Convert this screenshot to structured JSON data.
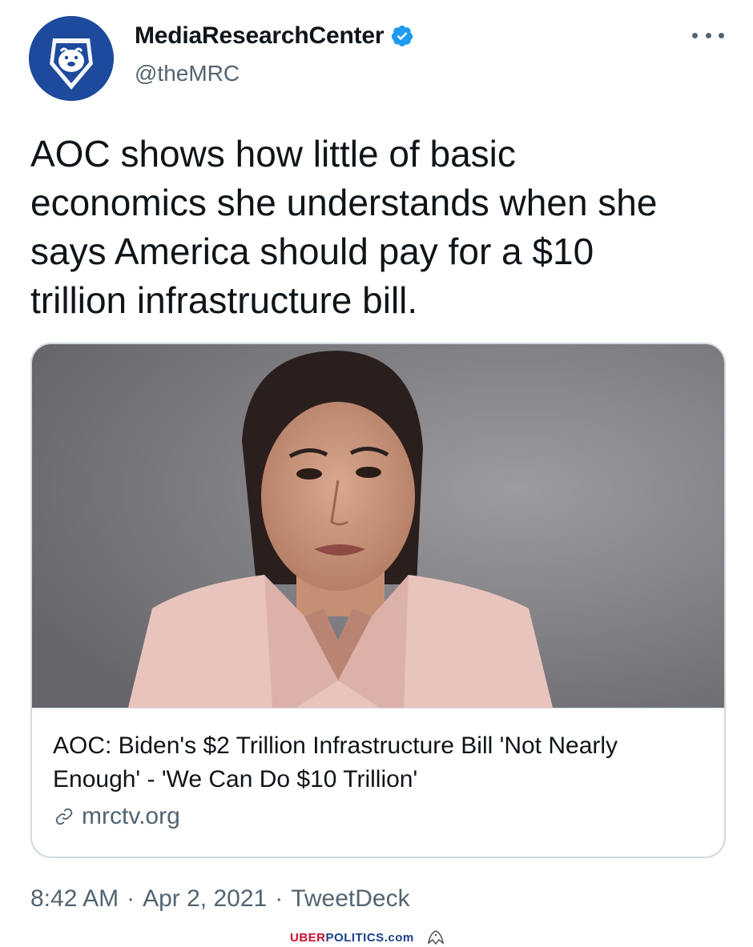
{
  "author": {
    "display_name": "MediaResearchCenter",
    "handle": "@theMRC",
    "verified": true
  },
  "tweet": {
    "text": "AOC shows how little of basic\neconomics she understands when she\nsays America should pay for a $10\ntrillion infrastructure bill."
  },
  "card": {
    "title": "AOC: Biden's $2 Trillion Infrastructure Bill 'Not Nearly Enough' - 'We Can Do $10 Trillion'",
    "domain": "mrctv.org",
    "image_icon": "photo-woman-pink-blazer"
  },
  "meta": {
    "time": "8:42 AM",
    "separator": "·",
    "date": "Apr 2, 2021",
    "source": "TweetDeck"
  },
  "watermark": {
    "part1": "UBER",
    "part2": "POLITICS",
    "part3": ".com"
  },
  "colors": {
    "avatar_bg": "#1d4a9c",
    "verified_blue": "#1d9bf0",
    "secondary_text": "#536471",
    "border": "#cfd9de",
    "blazer_pink": "#e9c4bd"
  },
  "icons": {
    "more": "more-horizontal-icon",
    "verified": "verified-badge-icon",
    "link": "link-icon",
    "avatar": "bulldog-logo"
  }
}
